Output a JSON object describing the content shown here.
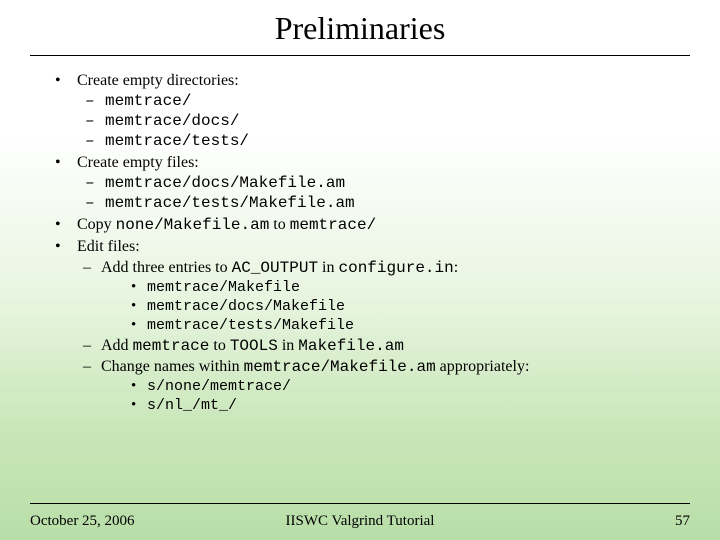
{
  "title": "Preliminaries",
  "bullets": {
    "b1": "Create empty directories:",
    "b1_items": {
      "a": "memtrace/",
      "b": "memtrace/docs/",
      "c": "memtrace/tests/"
    },
    "b2": "Create empty files:",
    "b2_items": {
      "a": "memtrace/docs/Makefile.am",
      "b": "memtrace/tests/Makefile.am"
    },
    "b3_pre": "Copy ",
    "b3_code1": "none/Makefile.am",
    "b3_mid": " to ",
    "b3_code2": "memtrace/",
    "b4": "Edit files:",
    "b4a_pre": "Add three entries to ",
    "b4a_code1": "AC_OUTPUT",
    "b4a_mid": " in  ",
    "b4a_code2": "configure.in",
    "b4a_post": ":",
    "b4a_items": {
      "a": "memtrace/Makefile",
      "b": "memtrace/docs/Makefile",
      "c": "memtrace/tests/Makefile"
    },
    "b4b_pre": "Add ",
    "b4b_code1": "memtrace",
    "b4b_mid": " to ",
    "b4b_code2": "TOOLS",
    "b4b_mid2": " in ",
    "b4b_code3": "Makefile.am",
    "b4c_pre": "Change names within ",
    "b4c_code1": "memtrace/Makefile.am",
    "b4c_post": " appropriately:",
    "b4c_items": {
      "a": "s/none/memtrace/",
      "b": "s/nl_/mt_/"
    }
  },
  "footer": {
    "date": "October 25, 2006",
    "center": "IISWC Valgrind Tutorial",
    "page": "57"
  }
}
